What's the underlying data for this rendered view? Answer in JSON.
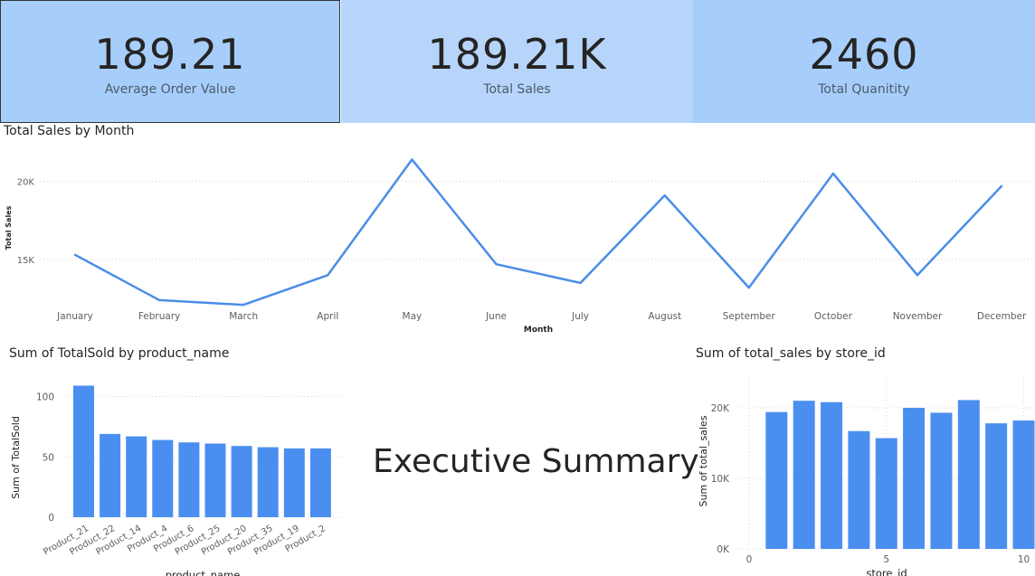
{
  "kpis": [
    {
      "value": "189.21",
      "label": "Average Order Value"
    },
    {
      "value": "189.21K",
      "label": "Total Sales"
    },
    {
      "value": "2460",
      "label": "Total Quanitity"
    }
  ],
  "colors": {
    "series": "#4a8ee8",
    "bar": "#4a8ff0",
    "kpi_bg": "#a7cefb",
    "kpi_bg_selected": "#b7d5fb"
  },
  "summary_title": "Executive Summary",
  "chart_data": [
    {
      "type": "line",
      "title": "Total Sales by Month",
      "xlabel": "Month",
      "ylabel": "Total Sales",
      "categories": [
        "January",
        "February",
        "March",
        "April",
        "May",
        "June",
        "July",
        "August",
        "September",
        "October",
        "November",
        "December"
      ],
      "values": [
        15300,
        12400,
        12100,
        14000,
        21400,
        14700,
        13500,
        19100,
        13200,
        20500,
        14000,
        19700
      ],
      "yticks": [
        {
          "v": 15000,
          "label": "15K"
        },
        {
          "v": 20000,
          "label": "20K"
        }
      ],
      "grid": true
    },
    {
      "type": "bar",
      "title": "Sum of TotalSold by product_name",
      "xlabel": "product_name",
      "ylabel": "Sum of TotalSold",
      "categories": [
        "Product_21",
        "Product_22",
        "Product_14",
        "Product_4",
        "Product_6",
        "Product_25",
        "Product_20",
        "Product_35",
        "Product_19",
        "Product_2"
      ],
      "values": [
        109,
        69,
        67,
        64,
        62,
        61,
        59,
        58,
        57,
        57
      ],
      "ylim": [
        0,
        115
      ],
      "yticks": [
        {
          "v": 0,
          "label": "0"
        },
        {
          "v": 50,
          "label": "50"
        },
        {
          "v": 100,
          "label": "100"
        }
      ],
      "grid": true
    },
    {
      "type": "bar",
      "title": "Sum of total_sales by store_id",
      "xlabel": "store_id",
      "ylabel": "Sum of total_sales",
      "x": [
        1,
        2,
        3,
        4,
        5,
        6,
        7,
        8,
        9,
        10
      ],
      "values": [
        19400,
        21000,
        20800,
        16700,
        15700,
        20000,
        19300,
        21100,
        17800,
        18200
      ],
      "ylim": [
        0,
        24000
      ],
      "yticks": [
        {
          "v": 0,
          "label": "0K"
        },
        {
          "v": 10000,
          "label": "10K"
        },
        {
          "v": 20000,
          "label": "20K"
        }
      ],
      "xticks": [
        {
          "v": 0,
          "label": "0"
        },
        {
          "v": 5,
          "label": "5"
        },
        {
          "v": 10,
          "label": "10"
        }
      ],
      "grid": true
    }
  ]
}
